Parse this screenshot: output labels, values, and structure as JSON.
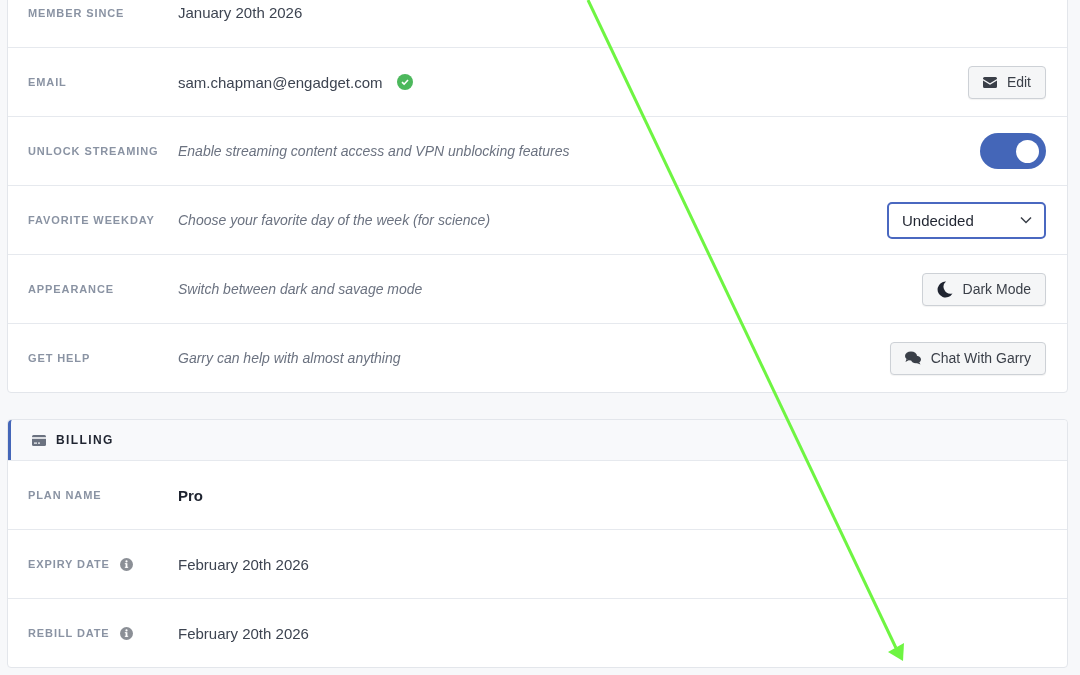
{
  "account": {
    "rows": [
      {
        "kind": "text",
        "label": "MEMBER SINCE",
        "value": "January 20th 2026"
      },
      {
        "kind": "email",
        "label": "EMAIL",
        "value": "sam.chapman@engadget.com",
        "verified": true,
        "button": {
          "label": "Edit",
          "kind": "edit"
        }
      },
      {
        "kind": "toggle",
        "label": "UNLOCK STREAMING",
        "description": "Enable streaming content access and VPN unblocking features",
        "on": true
      },
      {
        "kind": "select",
        "label": "FAVORITE WEEKDAY",
        "description": "Choose your favorite day of the week (for science)",
        "value": "Undecided"
      },
      {
        "kind": "button",
        "label": "APPEARANCE",
        "description": "Switch between dark and savage mode",
        "button": {
          "label": "Dark Mode",
          "kind": "theme"
        }
      },
      {
        "kind": "button",
        "label": "GET HELP",
        "description": "Garry can help with almost anything",
        "button": {
          "label": "Chat With Garry",
          "kind": "chat"
        }
      }
    ]
  },
  "billing": {
    "title": "BILLING",
    "rows": [
      {
        "kind": "plan",
        "label": "PLAN NAME",
        "value": "Pro",
        "info": false
      },
      {
        "kind": "text",
        "label": "EXPIRY DATE",
        "value": "February 20th 2026",
        "info": true
      },
      {
        "kind": "text",
        "label": "REBILL DATE",
        "value": "February 20th 2026",
        "info": true
      }
    ]
  }
}
